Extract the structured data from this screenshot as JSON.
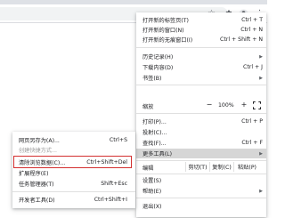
{
  "toolbar": {
    "star_icon": "star-icon",
    "extension_icon": "puzzle-icon",
    "avatar_icon": "avatar-icon",
    "menu_icon": "kebab-menu-icon"
  },
  "menu": {
    "new_tab": {
      "label": "打开新的标签页(T)",
      "shortcut": "Ctrl + T"
    },
    "new_window": {
      "label": "打开新的窗口(N)",
      "shortcut": "Ctrl + N"
    },
    "new_incognito": {
      "label": "打开新的无痕窗口(I)",
      "shortcut": "Ctrl + Shift + N"
    },
    "history": {
      "label": "历史记录(H)"
    },
    "downloads": {
      "label": "下载内容(D)",
      "shortcut": "Ctrl + J"
    },
    "bookmarks": {
      "label": "书签(B)"
    },
    "zoom": {
      "label": "缩放",
      "minus": "−",
      "value": "100%",
      "plus": "+"
    },
    "print": {
      "label": "打印(P)...",
      "shortcut": "Ctrl + P"
    },
    "cast": {
      "label": "投射(C)..."
    },
    "find": {
      "label": "查找(F)...",
      "shortcut": "Ctrl + F"
    },
    "more_tools": {
      "label": "更多工具(L)"
    },
    "edit": {
      "label": "编辑",
      "cut": "剪切(T)",
      "copy": "复制(C)",
      "paste": "粘贴(P)"
    },
    "settings": {
      "label": "设置(S)"
    },
    "help": {
      "label": "帮助(E)"
    },
    "exit": {
      "label": "退出(X)"
    }
  },
  "submenu": {
    "save_page": {
      "label": "网页另存为(A)...",
      "shortcut": "Ctrl+S"
    },
    "create_shortcut": {
      "label": "创建快捷方式..."
    },
    "clear_data": {
      "label": "清除浏览数据(C)...",
      "shortcut": "Ctrl+Shift+Del"
    },
    "extensions": {
      "label": "扩展程序(E)"
    },
    "task_manager": {
      "label": "任务管理器(T)",
      "shortcut": "Shift+Esc"
    },
    "dev_tools": {
      "label": "开发者工具(D)",
      "shortcut": "Ctrl+Shift+I"
    }
  },
  "colors": {
    "highlight_border": "#d32f2f",
    "hover_bg": "#d6d6d6"
  }
}
